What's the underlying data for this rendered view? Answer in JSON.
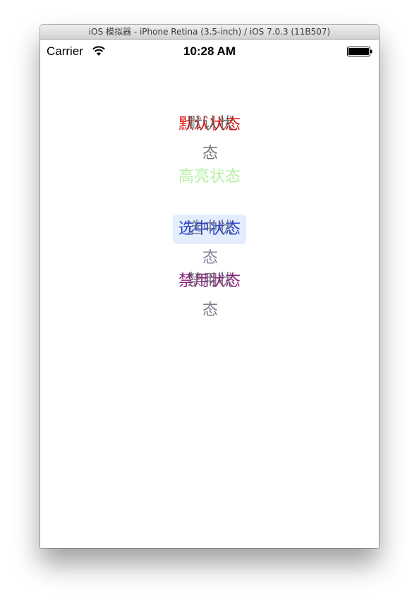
{
  "window": {
    "title": "iOS 模拟器 - iPhone Retina (3.5-inch) / iOS 7.0.3 (11B507)"
  },
  "status_bar": {
    "carrier": "Carrier",
    "time": "10:28 AM",
    "icons": [
      "wifi-icon",
      "battery-icon"
    ]
  },
  "buttons": {
    "default_label": "默认状态",
    "highlighted_label": "高亮状态",
    "selected_label": "选中状态",
    "disabled_label": "禁用状态"
  },
  "colors": {
    "default_title": "#dd1111",
    "highlighted_title": "#b6f0a5",
    "selected_title": "#2a3fd0",
    "selected_background": "#e3edfb",
    "disabled_title": "#8b1f7a"
  }
}
